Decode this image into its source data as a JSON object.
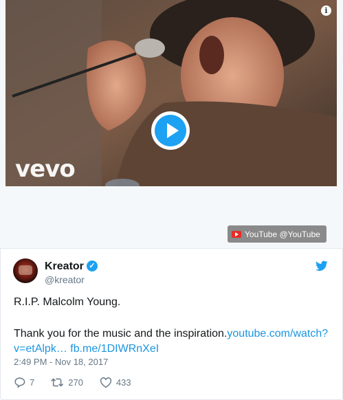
{
  "media": {
    "watermark": "vevo",
    "source_label": "YouTube @YouTube",
    "info_glyph": "i",
    "icons": {
      "info": "info-icon",
      "play": "play-icon",
      "youtube": "youtube-icon"
    }
  },
  "tweet": {
    "display_name": "Kreator",
    "handle": "@kreator",
    "verified": true,
    "verified_glyph": "✓",
    "line1": "R.I.P. Malcolm Young.",
    "line2_text": "Thank you for the music and the inspiration.",
    "link_youtube": "youtube.com/watch?v=etAlpk…",
    "link_fb": "fb.me/1DIWRnXeI",
    "timestamp": "2:49 PM - Nov 18, 2017",
    "replies": "7",
    "retweets": "270",
    "likes": "433",
    "icons": {
      "brand": "twitter-bird-icon",
      "reply": "reply-icon",
      "retweet": "retweet-icon",
      "like": "heart-icon",
      "verified": "verified-badge-icon"
    }
  },
  "colors": {
    "accent": "#1da1f2",
    "link": "#1b95e0",
    "muted_text": "#657786",
    "primary_text": "#14171a",
    "youtube_red": "#e52d27"
  }
}
